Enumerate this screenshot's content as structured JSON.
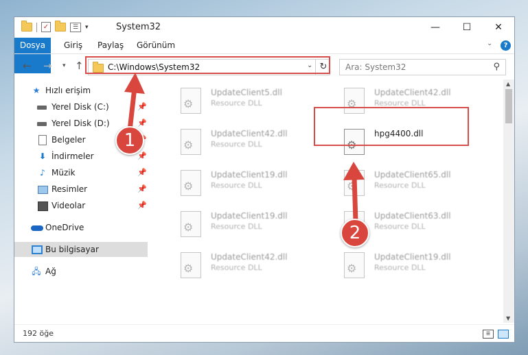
{
  "window": {
    "title": "System32",
    "controls": {
      "minimize": "—",
      "maximize": "☐",
      "close": "✕"
    }
  },
  "ribbon": {
    "tabs": [
      "Dosya",
      "Giriş",
      "Paylaş",
      "Görünüm"
    ],
    "help": "?"
  },
  "nav": {
    "address": "C:\\Windows\\System32",
    "search_placeholder": "Ara: System32"
  },
  "sidebar": {
    "items": [
      {
        "label": "Hızlı erişim",
        "icon": "star-icon"
      },
      {
        "label": "Yerel Disk (C:)",
        "icon": "drive-icon"
      },
      {
        "label": "Yerel Disk (D:)",
        "icon": "drive-icon"
      },
      {
        "label": "Belgeler",
        "icon": "documents-icon"
      },
      {
        "label": "İndirmeler",
        "icon": "download-icon"
      },
      {
        "label": "Müzik",
        "icon": "music-icon"
      },
      {
        "label": "Resimler",
        "icon": "pictures-icon"
      },
      {
        "label": "Videolar",
        "icon": "videos-icon"
      },
      {
        "label": "OneDrive",
        "icon": "onedrive-icon"
      },
      {
        "label": "Bu bilgisayar",
        "icon": "computer-icon"
      },
      {
        "label": "Ağ",
        "icon": "network-icon"
      }
    ]
  },
  "files": [
    {
      "name": "UpdateClient5.dll",
      "type": "Resource DLL"
    },
    {
      "name": "UpdateClient42.dll",
      "type": "Resource DLL"
    },
    {
      "name": "UpdateClient42.dll",
      "type": "Resource DLL"
    },
    {
      "name": "hpg4400.dll",
      "type": ""
    },
    {
      "name": "UpdateClient19.dll",
      "type": "Resource DLL"
    },
    {
      "name": "UpdateClient65.dll",
      "type": "Resource DLL"
    },
    {
      "name": "UpdateClient19.dll",
      "type": "Resource DLL"
    },
    {
      "name": "UpdateClient63.dll",
      "type": "Resource DLL"
    },
    {
      "name": "UpdateClient42.dll",
      "type": "Resource DLL"
    },
    {
      "name": "UpdateClient19.dll",
      "type": "Resource DLL"
    }
  ],
  "status": {
    "count": "192 öğe"
  },
  "annotations": {
    "step1": "1",
    "step2": "2",
    "color": "#d84b4b"
  }
}
